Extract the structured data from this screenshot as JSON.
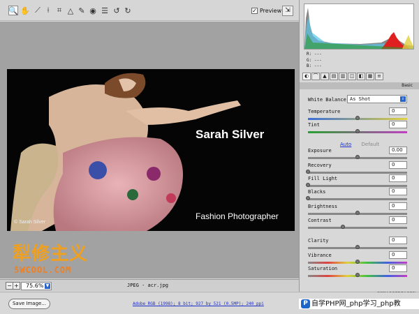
{
  "toolbar": {
    "tools": [
      "zoom-icon",
      "hand-icon",
      "white-balance-icon",
      "color-sampler-icon",
      "crop-icon",
      "straighten-icon",
      "retouch-icon",
      "red-eye-icon",
      "preferences-icon",
      "rotate-left-icon",
      "rotate-right-icon"
    ],
    "preview_label": "Preview",
    "preview_checked": "✓"
  },
  "photo": {
    "title": "Sarah Silver",
    "subtitle": "Fashion Photographer",
    "copyright": "© Sarah Silver"
  },
  "watermark": {
    "cn": "犁修主义",
    "en": "5WCOOL.COM",
    "php": "自学PHP网_php学习_php教",
    "site": "www.ocuzi.com"
  },
  "status": {
    "zoom": "75.6%",
    "filename": "JPEG  -  acr.jpg"
  },
  "bottom": {
    "save_label": "Save Image...",
    "info": "Adobe RGB (1998); 8 bit; 927 by 521 (0.5MP); 240 ppi"
  },
  "panel": {
    "rgb": {
      "r": "R:  ---",
      "g": "G:  ---",
      "b": "B:  ---"
    },
    "section": "Basic",
    "white_balance_label": "White Balance:",
    "white_balance_value": "As Shot",
    "auto": "Auto",
    "default": "Default",
    "sliders": [
      {
        "label": "Temperature",
        "value": "0",
        "pos": 0.5,
        "kind": "temp"
      },
      {
        "label": "Tint",
        "value": "0",
        "pos": 0.5,
        "kind": "tint"
      },
      {
        "label": "Exposure",
        "value": "0.00",
        "pos": 0.5,
        "kind": ""
      },
      {
        "label": "Recovery",
        "value": "0",
        "pos": 0.0,
        "kind": ""
      },
      {
        "label": "Fill Light",
        "value": "0",
        "pos": 0.0,
        "kind": ""
      },
      {
        "label": "Blacks",
        "value": "0",
        "pos": 0.0,
        "kind": ""
      },
      {
        "label": "Brightness",
        "value": "0",
        "pos": 0.5,
        "kind": ""
      },
      {
        "label": "Contrast",
        "value": "0",
        "pos": 0.35,
        "kind": ""
      },
      {
        "label": "Clarity",
        "value": "0",
        "pos": 0.5,
        "kind": ""
      },
      {
        "label": "Vibrance",
        "value": "0",
        "pos": 0.5,
        "kind": "vib"
      },
      {
        "label": "Saturation",
        "value": "0",
        "pos": 0.5,
        "kind": "sat"
      }
    ]
  }
}
